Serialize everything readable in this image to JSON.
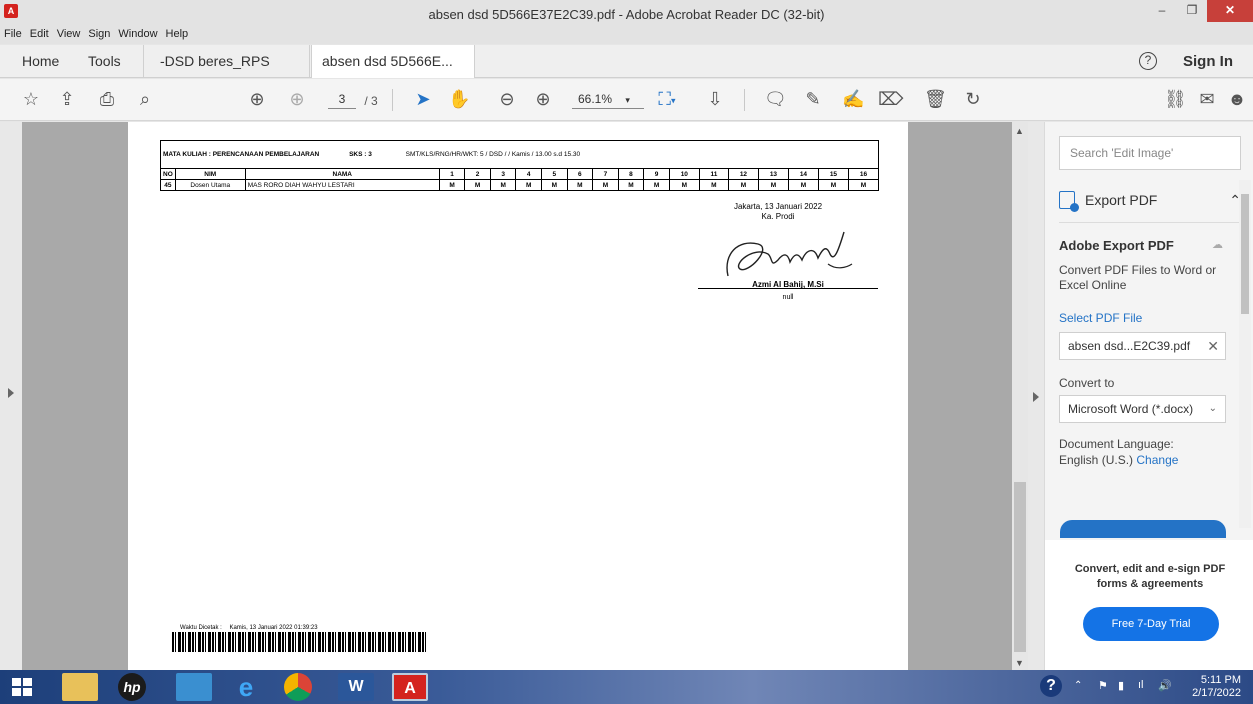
{
  "window": {
    "title": "absen dsd 5D566E37E2C39.pdf - Adobe Acrobat Reader DC (32-bit)",
    "app_icon": "acrobat-icon"
  },
  "menu": [
    "File",
    "Edit",
    "View",
    "Sign",
    "Window",
    "Help"
  ],
  "tabs": {
    "home": "Home",
    "tools": "Tools",
    "doc1": "-DSD beres_RPS PE...",
    "doc2": "absen dsd 5D566E...",
    "close_glyph": "×",
    "help_glyph": "?",
    "signin": "Sign In"
  },
  "toolbar": {
    "page_current": "3",
    "page_total": "/ 3",
    "zoom": "66.1%"
  },
  "document": {
    "header_course": "MATA KULIAH : PERENCANAAN PEMBELAJARAN",
    "header_sks": "SKS : 3",
    "header_info": "SMT/KLS/RNG/HR/WKT: 5 / DSD / / Kamis / 13.00 s.d 15.30",
    "col_no": "NO",
    "col_nim": "NIM",
    "col_nama": "NAMA",
    "sessions": [
      "1",
      "2",
      "3",
      "4",
      "5",
      "6",
      "7",
      "8",
      "9",
      "10",
      "11",
      "12",
      "13",
      "14",
      "15",
      "16"
    ],
    "row": {
      "no": "45",
      "nim": "Dosen Utama",
      "nama": "MAS RORO DIAH WAHYU LESTARI",
      "marks": [
        "M",
        "M",
        "M",
        "M",
        "M",
        "M",
        "M",
        "M",
        "M",
        "M",
        "M",
        "M",
        "M",
        "M",
        "M",
        "M"
      ]
    },
    "place_date": "Jakarta, 13 Januari 2022",
    "role": "Ka. Prodi",
    "signer": "Azmi Al Bahij, M.Si",
    "signer_sub": "null",
    "printed_label": "Waktu Dicetak :",
    "printed_value": "Kamis, 13 Januari 2022 01:39:23"
  },
  "panel": {
    "search_placeholder": "Search 'Edit Image'",
    "export_title": "Export PDF",
    "ae_title": "Adobe Export PDF",
    "ae_desc": "Convert PDF Files to Word or Excel Online",
    "select_label": "Select PDF File",
    "file_name": "absen dsd...E2C39.pdf",
    "convert_to": "Convert to",
    "format": "Microsoft Word (*.docx)",
    "lang_label": "Document Language:",
    "lang_value": "English (U.S.)",
    "lang_change": "Change",
    "promo_text": "Convert, edit and e-sign PDF forms & agreements",
    "trial_btn": "Free 7-Day Trial"
  },
  "taskbar": {
    "time": "5:11 PM",
    "date": "2/17/2022"
  },
  "colors": {
    "accent": "#2473c6",
    "acrobat_red": "#d4231e"
  }
}
